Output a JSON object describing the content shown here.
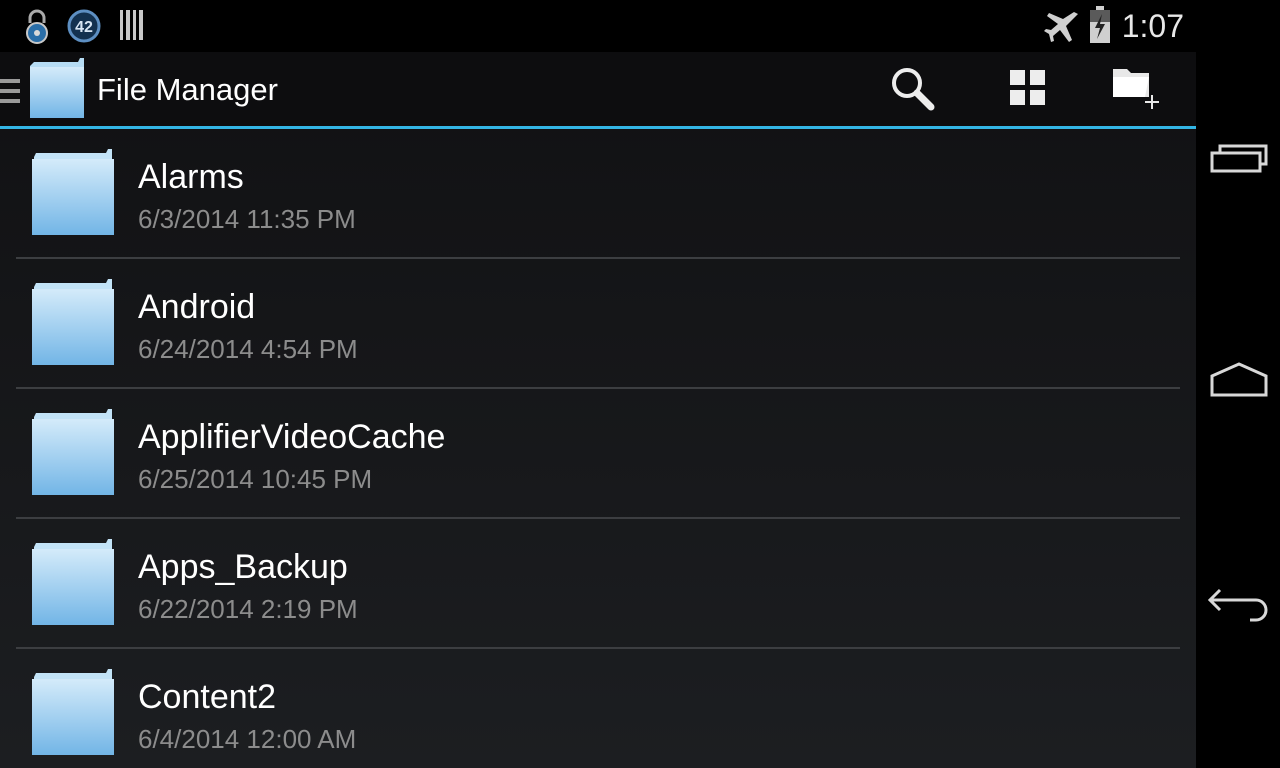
{
  "status_bar": {
    "time": "1:07",
    "notification_badge": "42",
    "left_icons": [
      "lock-icon",
      "badge-42-icon",
      "barcode-icon"
    ],
    "right_icons": [
      "airplane-mode-icon",
      "battery-charging-icon"
    ]
  },
  "action_bar": {
    "title": "File Manager",
    "actions": [
      "search-icon",
      "grid-view-icon",
      "new-folder-icon"
    ]
  },
  "files": [
    {
      "name": "Alarms",
      "date": "6/3/2014 11:35 PM"
    },
    {
      "name": "Android",
      "date": "6/24/2014 4:54 PM"
    },
    {
      "name": "ApplifierVideoCache",
      "date": "6/25/2014 10:45 PM"
    },
    {
      "name": "Apps_Backup",
      "date": "6/22/2014 2:19 PM"
    },
    {
      "name": "Content2",
      "date": "6/4/2014 12:00 AM"
    }
  ],
  "nav_bar": {
    "buttons": [
      "recent-apps-icon",
      "home-icon",
      "back-icon"
    ]
  },
  "colors": {
    "accent": "#33b5e5",
    "folder": "#8ec8ec",
    "background": "#151618"
  }
}
